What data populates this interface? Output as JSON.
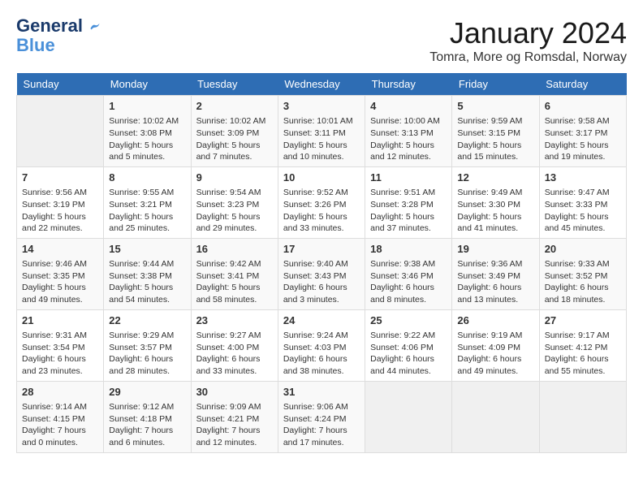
{
  "logo": {
    "line1": "General",
    "line2": "Blue"
  },
  "title": "January 2024",
  "location": "Tomra, More og Romsdal, Norway",
  "days_of_week": [
    "Sunday",
    "Monday",
    "Tuesday",
    "Wednesday",
    "Thursday",
    "Friday",
    "Saturday"
  ],
  "weeks": [
    [
      {
        "day": "",
        "empty": true
      },
      {
        "day": "1",
        "sunrise": "Sunrise: 10:02 AM",
        "sunset": "Sunset: 3:08 PM",
        "daylight": "Daylight: 5 hours and 5 minutes."
      },
      {
        "day": "2",
        "sunrise": "Sunrise: 10:02 AM",
        "sunset": "Sunset: 3:09 PM",
        "daylight": "Daylight: 5 hours and 7 minutes."
      },
      {
        "day": "3",
        "sunrise": "Sunrise: 10:01 AM",
        "sunset": "Sunset: 3:11 PM",
        "daylight": "Daylight: 5 hours and 10 minutes."
      },
      {
        "day": "4",
        "sunrise": "Sunrise: 10:00 AM",
        "sunset": "Sunset: 3:13 PM",
        "daylight": "Daylight: 5 hours and 12 minutes."
      },
      {
        "day": "5",
        "sunrise": "Sunrise: 9:59 AM",
        "sunset": "Sunset: 3:15 PM",
        "daylight": "Daylight: 5 hours and 15 minutes."
      },
      {
        "day": "6",
        "sunrise": "Sunrise: 9:58 AM",
        "sunset": "Sunset: 3:17 PM",
        "daylight": "Daylight: 5 hours and 19 minutes."
      }
    ],
    [
      {
        "day": "7",
        "sunrise": "Sunrise: 9:56 AM",
        "sunset": "Sunset: 3:19 PM",
        "daylight": "Daylight: 5 hours and 22 minutes."
      },
      {
        "day": "8",
        "sunrise": "Sunrise: 9:55 AM",
        "sunset": "Sunset: 3:21 PM",
        "daylight": "Daylight: 5 hours and 25 minutes."
      },
      {
        "day": "9",
        "sunrise": "Sunrise: 9:54 AM",
        "sunset": "Sunset: 3:23 PM",
        "daylight": "Daylight: 5 hours and 29 minutes."
      },
      {
        "day": "10",
        "sunrise": "Sunrise: 9:52 AM",
        "sunset": "Sunset: 3:26 PM",
        "daylight": "Daylight: 5 hours and 33 minutes."
      },
      {
        "day": "11",
        "sunrise": "Sunrise: 9:51 AM",
        "sunset": "Sunset: 3:28 PM",
        "daylight": "Daylight: 5 hours and 37 minutes."
      },
      {
        "day": "12",
        "sunrise": "Sunrise: 9:49 AM",
        "sunset": "Sunset: 3:30 PM",
        "daylight": "Daylight: 5 hours and 41 minutes."
      },
      {
        "day": "13",
        "sunrise": "Sunrise: 9:47 AM",
        "sunset": "Sunset: 3:33 PM",
        "daylight": "Daylight: 5 hours and 45 minutes."
      }
    ],
    [
      {
        "day": "14",
        "sunrise": "Sunrise: 9:46 AM",
        "sunset": "Sunset: 3:35 PM",
        "daylight": "Daylight: 5 hours and 49 minutes."
      },
      {
        "day": "15",
        "sunrise": "Sunrise: 9:44 AM",
        "sunset": "Sunset: 3:38 PM",
        "daylight": "Daylight: 5 hours and 54 minutes."
      },
      {
        "day": "16",
        "sunrise": "Sunrise: 9:42 AM",
        "sunset": "Sunset: 3:41 PM",
        "daylight": "Daylight: 5 hours and 58 minutes."
      },
      {
        "day": "17",
        "sunrise": "Sunrise: 9:40 AM",
        "sunset": "Sunset: 3:43 PM",
        "daylight": "Daylight: 6 hours and 3 minutes."
      },
      {
        "day": "18",
        "sunrise": "Sunrise: 9:38 AM",
        "sunset": "Sunset: 3:46 PM",
        "daylight": "Daylight: 6 hours and 8 minutes."
      },
      {
        "day": "19",
        "sunrise": "Sunrise: 9:36 AM",
        "sunset": "Sunset: 3:49 PM",
        "daylight": "Daylight: 6 hours and 13 minutes."
      },
      {
        "day": "20",
        "sunrise": "Sunrise: 9:33 AM",
        "sunset": "Sunset: 3:52 PM",
        "daylight": "Daylight: 6 hours and 18 minutes."
      }
    ],
    [
      {
        "day": "21",
        "sunrise": "Sunrise: 9:31 AM",
        "sunset": "Sunset: 3:54 PM",
        "daylight": "Daylight: 6 hours and 23 minutes."
      },
      {
        "day": "22",
        "sunrise": "Sunrise: 9:29 AM",
        "sunset": "Sunset: 3:57 PM",
        "daylight": "Daylight: 6 hours and 28 minutes."
      },
      {
        "day": "23",
        "sunrise": "Sunrise: 9:27 AM",
        "sunset": "Sunset: 4:00 PM",
        "daylight": "Daylight: 6 hours and 33 minutes."
      },
      {
        "day": "24",
        "sunrise": "Sunrise: 9:24 AM",
        "sunset": "Sunset: 4:03 PM",
        "daylight": "Daylight: 6 hours and 38 minutes."
      },
      {
        "day": "25",
        "sunrise": "Sunrise: 9:22 AM",
        "sunset": "Sunset: 4:06 PM",
        "daylight": "Daylight: 6 hours and 44 minutes."
      },
      {
        "day": "26",
        "sunrise": "Sunrise: 9:19 AM",
        "sunset": "Sunset: 4:09 PM",
        "daylight": "Daylight: 6 hours and 49 minutes."
      },
      {
        "day": "27",
        "sunrise": "Sunrise: 9:17 AM",
        "sunset": "Sunset: 4:12 PM",
        "daylight": "Daylight: 6 hours and 55 minutes."
      }
    ],
    [
      {
        "day": "28",
        "sunrise": "Sunrise: 9:14 AM",
        "sunset": "Sunset: 4:15 PM",
        "daylight": "Daylight: 7 hours and 0 minutes."
      },
      {
        "day": "29",
        "sunrise": "Sunrise: 9:12 AM",
        "sunset": "Sunset: 4:18 PM",
        "daylight": "Daylight: 7 hours and 6 minutes."
      },
      {
        "day": "30",
        "sunrise": "Sunrise: 9:09 AM",
        "sunset": "Sunset: 4:21 PM",
        "daylight": "Daylight: 7 hours and 12 minutes."
      },
      {
        "day": "31",
        "sunrise": "Sunrise: 9:06 AM",
        "sunset": "Sunset: 4:24 PM",
        "daylight": "Daylight: 7 hours and 17 minutes."
      },
      {
        "day": "",
        "empty": true
      },
      {
        "day": "",
        "empty": true
      },
      {
        "day": "",
        "empty": true
      }
    ]
  ]
}
